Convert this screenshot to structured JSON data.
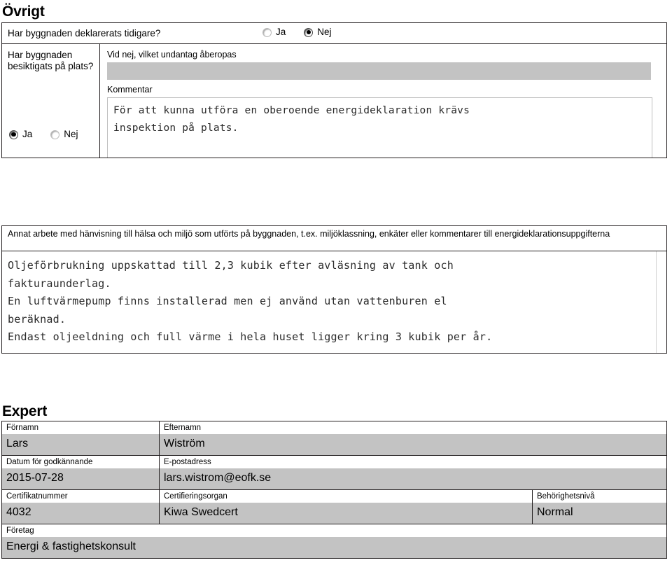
{
  "sections": {
    "ovrigt": {
      "heading": "Övrigt",
      "declared_question": "Har byggnaden deklarerats tidigare?",
      "declared_options": [
        {
          "label": "Ja",
          "checked": false
        },
        {
          "label": "Nej",
          "checked": true
        }
      ],
      "inspected_question": "Har byggnaden besiktigats på plats?",
      "inspected_options": [
        {
          "label": "Ja",
          "checked": true
        },
        {
          "label": "Nej",
          "checked": false
        }
      ],
      "undantag_label": "Vid nej, vilket undantag åberopas",
      "undantag_value": "",
      "kommentar_label": "Kommentar",
      "kommentar_value": "För att kunna utföra en oberoende energideklaration krävs\ninspektion på plats."
    },
    "annat_arbete": {
      "label": "Annat arbete med hänvisning till hälsa och miljö som utförts på byggnaden, t.ex. miljöklassning, enkäter eller kommentarer till energideklarationsuppgifterna",
      "value": "Oljeförbrukning uppskattad till 2,3 kubik efter avläsning av tank och\nfakturaunderlag.\nEn luftvärmepump finns installerad men ej använd utan vattenburen el\nberäknad.\nEndast oljeeldning och full värme i hela huset ligger kring 3 kubik per år."
    },
    "expert": {
      "heading": "Expert",
      "rows": [
        {
          "cells": [
            {
              "label": "Förnamn",
              "value": "Lars"
            },
            {
              "label": "Efternamn",
              "value": "Wiström"
            }
          ]
        },
        {
          "cells": [
            {
              "label": "Datum för godkännande",
              "value": "2015-07-28"
            },
            {
              "label": "E-postadress",
              "value": "lars.wistrom@eofk.se"
            }
          ]
        },
        {
          "cells": [
            {
              "label": "Certifikatnummer",
              "value": "4032"
            },
            {
              "label": "Certifieringsorgan",
              "value": "Kiwa Swedcert"
            },
            {
              "label": "Behörighetsnivå",
              "value": "Normal"
            }
          ]
        },
        {
          "cells": [
            {
              "label": "Företag",
              "value": "Energi & fastighetskonsult"
            }
          ]
        }
      ]
    }
  },
  "colors": {
    "field_gray": "#c3c3c3",
    "border_dark": "#231f20",
    "text": "#000000"
  }
}
